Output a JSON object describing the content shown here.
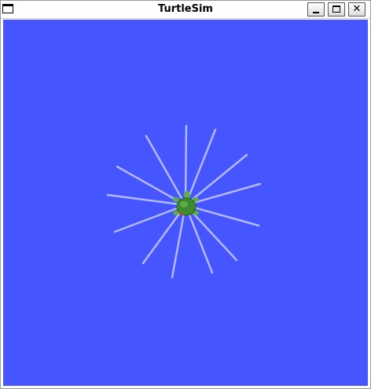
{
  "window": {
    "title": "TurtleSim",
    "buttons": {
      "minimize_icon": "minimize-icon",
      "maximize_icon": "maximize-icon",
      "close_icon": "close-icon",
      "close_glyph": "✕"
    }
  },
  "canvas": {
    "background_color": "#4555ff",
    "pen_color": "#b3b8ff",
    "turtle_shell_color": "#3e8a2e",
    "turtle_body_color": "#5cae45",
    "turtle_accent_color": "#d23a2a",
    "trail_count": 16
  }
}
